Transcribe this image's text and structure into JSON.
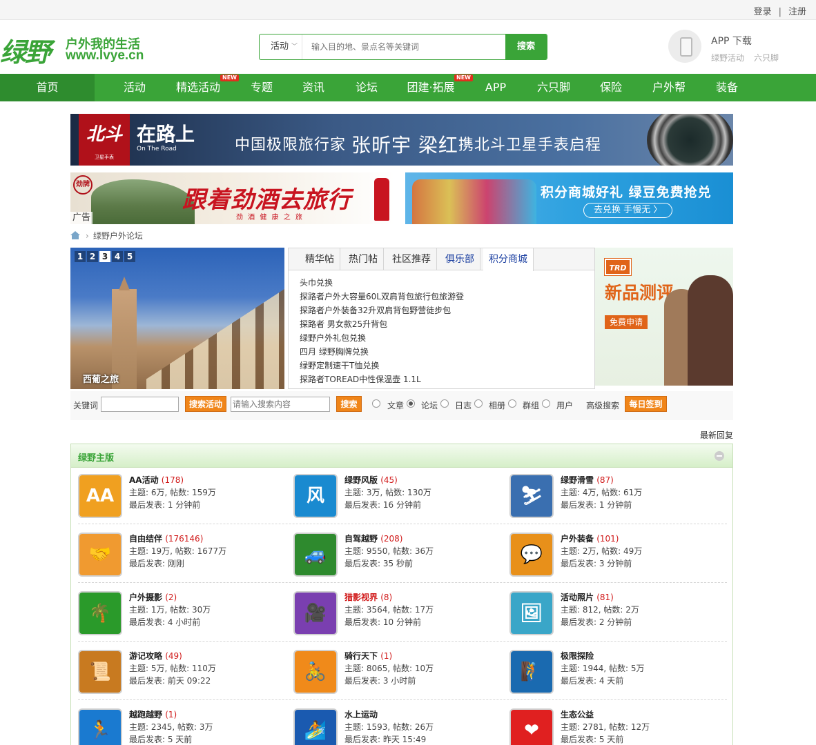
{
  "topbar": {
    "login": "登录",
    "sep": "|",
    "register": "注册"
  },
  "header": {
    "logo_big": "绿野",
    "logo_slogan": "户外我的生活",
    "logo_domain": "www.lvye.cn",
    "search_select": "活动",
    "search_placeholder": "输入目的地、景点名等关键词",
    "search_button": "搜索",
    "app_title": "APP 下载",
    "app_sub1": "绿野活动",
    "app_sub2": "六只脚"
  },
  "nav": {
    "items": [
      "首页",
      "活动",
      "精选活动",
      "专题",
      "资讯",
      "论坛",
      "团建·拓展",
      "APP",
      "六只脚",
      "保险",
      "户外帮",
      "装备"
    ],
    "new_badge": "NEW"
  },
  "banners": {
    "b1_brand": "北斗",
    "b1_brand_sub": "卫星手表",
    "b1_road": "在路上",
    "b1_road_en": "On The Road",
    "b1_text": "中国极限旅行家",
    "b1_names": "张昕宇 梁红",
    "b1_tail": "携北斗卫星手表启程",
    "b2_logo": "劲牌",
    "b2_slogan": "跟着劲酒去旅行",
    "b2_sub": "劲 酒 健 康 之 旅",
    "b2_adtag": "广告",
    "b3_line1": "积分商城好礼 绿豆免费抢兑",
    "b3_line2": "去兑换 手慢无 〉"
  },
  "breadcrumb": {
    "arrow": "›",
    "label": "绿野户外论坛"
  },
  "slider": {
    "dots": [
      "1",
      "2",
      "3",
      "4",
      "5"
    ],
    "active": 3,
    "caption": "西葡之旅"
  },
  "tabs": {
    "labels": [
      "精华帖",
      "热门帖",
      "社区推荐",
      "俱乐部",
      "积分商城"
    ],
    "items": [
      "头巾兑换",
      "探路者户外大容量60L双肩背包旅行包旅游登",
      "探路者户外装备32升双肩背包野营徒步包",
      "探路者 男女款25升背包",
      "绿野户外礼包兑换",
      "四月 绿野胸牌兑换",
      "绿野定制速干T恤兑换",
      "探路者TOREAD中性保温壶 1.1L"
    ]
  },
  "promo": {
    "logo": "TRD",
    "title": "新品测评",
    "button": "免费申请"
  },
  "searchrow": {
    "keyword_label": "关键词",
    "activity_button": "搜索活动",
    "content_placeholder": "请输入搜索内容",
    "search_button": "搜索",
    "options": [
      "文章",
      "论坛",
      "日志",
      "相册",
      "群组",
      "用户"
    ],
    "advanced": "高级搜索",
    "checkin": "每日签到"
  },
  "latest_reply": "最新回复",
  "forum": {
    "title": "绿野主版",
    "boards": [
      {
        "name": "AA活动",
        "count": "(178)",
        "stat": "主题: 6万, 帖数: 159万",
        "last": "最后发表: 1 分钟前",
        "icon": "aa-icon",
        "color": "#f0a020",
        "symbol": "AA"
      },
      {
        "name": "绿野风版",
        "count": "(45)",
        "stat": "主题: 3万, 帖数: 130万",
        "last": "最后发表: 16 分钟前",
        "icon": "wind-icon",
        "color": "#1a8ad0",
        "symbol": "风"
      },
      {
        "name": "绿野滑雪",
        "count": "(87)",
        "stat": "主题: 4万, 帖数: 61万",
        "last": "最后发表: 1 分钟前",
        "icon": "ski-icon",
        "color": "#3a6fb0",
        "symbol": "⛷"
      },
      {
        "name": "自由结伴",
        "count": "(176146)",
        "stat": "主题: 19万, 帖数: 1677万",
        "last": "最后发表: 刚刚",
        "icon": "handshake-icon",
        "color": "#f09a30",
        "symbol": "🤝"
      },
      {
        "name": "自驾越野",
        "count": "(208)",
        "stat": "主题: 9550, 帖数: 36万",
        "last": "最后发表: 35 秒前",
        "icon": "car-icon",
        "color": "#2e8a2e",
        "symbol": "🚙"
      },
      {
        "name": "户外装备",
        "count": "(101)",
        "stat": "主题: 2万, 帖数: 49万",
        "last": "最后发表: 3 分钟前",
        "icon": "chat-icon",
        "color": "#e8901a",
        "symbol": "💬"
      },
      {
        "name": "户外摄影",
        "count": "(2)",
        "stat": "主题: 1万, 帖数: 30万",
        "last": "最后发表: 4 小时前",
        "icon": "camera-palm-icon",
        "color": "#2a9a2a",
        "symbol": "🌴"
      },
      {
        "name": "猎影视界",
        "count": "(8)",
        "stat": "主题: 3564, 帖数: 17万",
        "last": "最后发表: 10 分钟前",
        "icon": "video-camera-icon",
        "color": "#7a3fb0",
        "symbol": "🎥",
        "red": true
      },
      {
        "name": "活动照片",
        "count": "(81)",
        "stat": "主题: 812, 帖数: 2万",
        "last": "最后发表: 2 分钟前",
        "icon": "photo-icon",
        "color": "#3aa6c8",
        "symbol": "🖼"
      },
      {
        "name": "游记攻略",
        "count": "(49)",
        "stat": "主题: 5万, 帖数: 110万",
        "last": "最后发表: 前天 09:22",
        "icon": "map-scroll-icon",
        "color": "#c87a20",
        "symbol": "📜"
      },
      {
        "name": "骑行天下",
        "count": "(1)",
        "stat": "主题: 8065, 帖数: 10万",
        "last": "最后发表: 3 小时前",
        "icon": "bicycle-icon",
        "color": "#f08a1a",
        "symbol": "🚴"
      },
      {
        "name": "极限探险",
        "count": "",
        "stat": "主题: 1944, 帖数: 5万",
        "last": "最后发表: 4 天前",
        "icon": "climber-icon",
        "color": "#1a6ab0",
        "symbol": "🧗"
      },
      {
        "name": "越跑越野",
        "count": "(1)",
        "stat": "主题: 2345, 帖数: 3万",
        "last": "最后发表: 5 天前",
        "icon": "runner-icon",
        "color": "#1a7ad0",
        "symbol": "🏃"
      },
      {
        "name": "水上运动",
        "count": "",
        "stat": "主题: 1593, 帖数: 26万",
        "last": "最后发表: 昨天 15:49",
        "icon": "surf-icon",
        "color": "#1a5ab0",
        "symbol": "🏄"
      },
      {
        "name": "生态公益",
        "count": "",
        "stat": "主题: 2781, 帖数: 12万",
        "last": "最后发表: 5 天前",
        "icon": "heart-icon",
        "color": "#e02020",
        "symbol": "❤"
      }
    ]
  }
}
